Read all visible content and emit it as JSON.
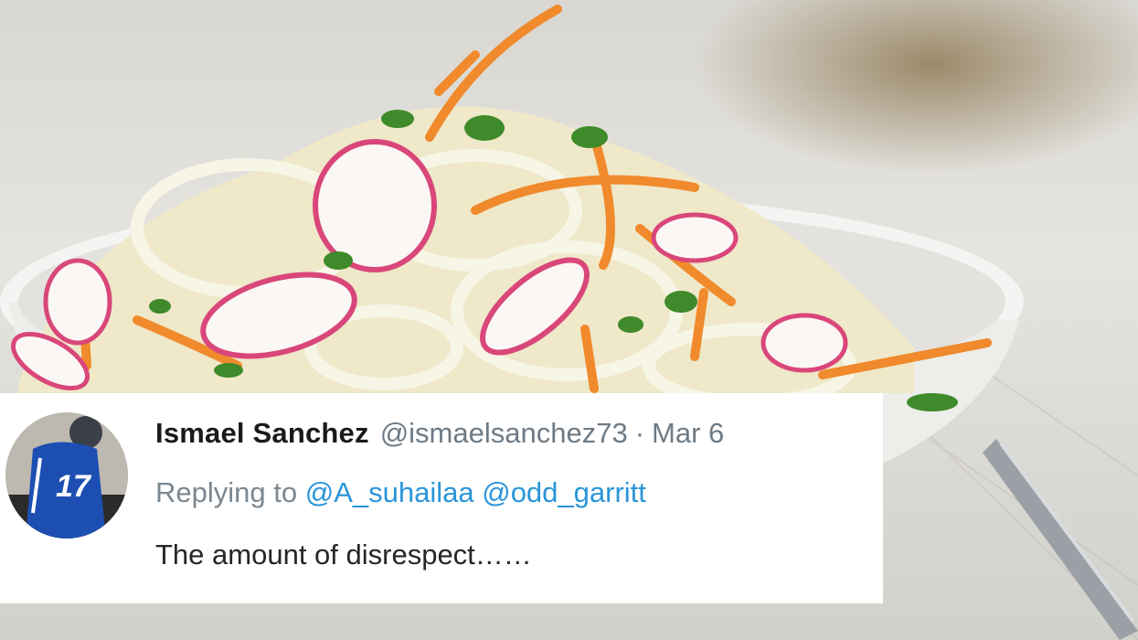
{
  "tweet": {
    "display_name": "Ismael Sanchez",
    "handle": "@ismaelsanchez73",
    "separator": "·",
    "date": "Mar 6",
    "replying_prefix": "Replying to",
    "replying_to": [
      "@A_suhailaa",
      "@odd_garritt"
    ],
    "text": "The amount of disrespect……",
    "avatar": {
      "jersey_number": "17",
      "jersey_color": "#1d4fb3"
    }
  },
  "background": {
    "subject": "salad",
    "colors": {
      "bowl": "#f3f3f1",
      "carrot": "#f08a2c",
      "radish": "#d9477a",
      "fennel": "#f1f0e2",
      "herb": "#3f8a2a"
    }
  }
}
